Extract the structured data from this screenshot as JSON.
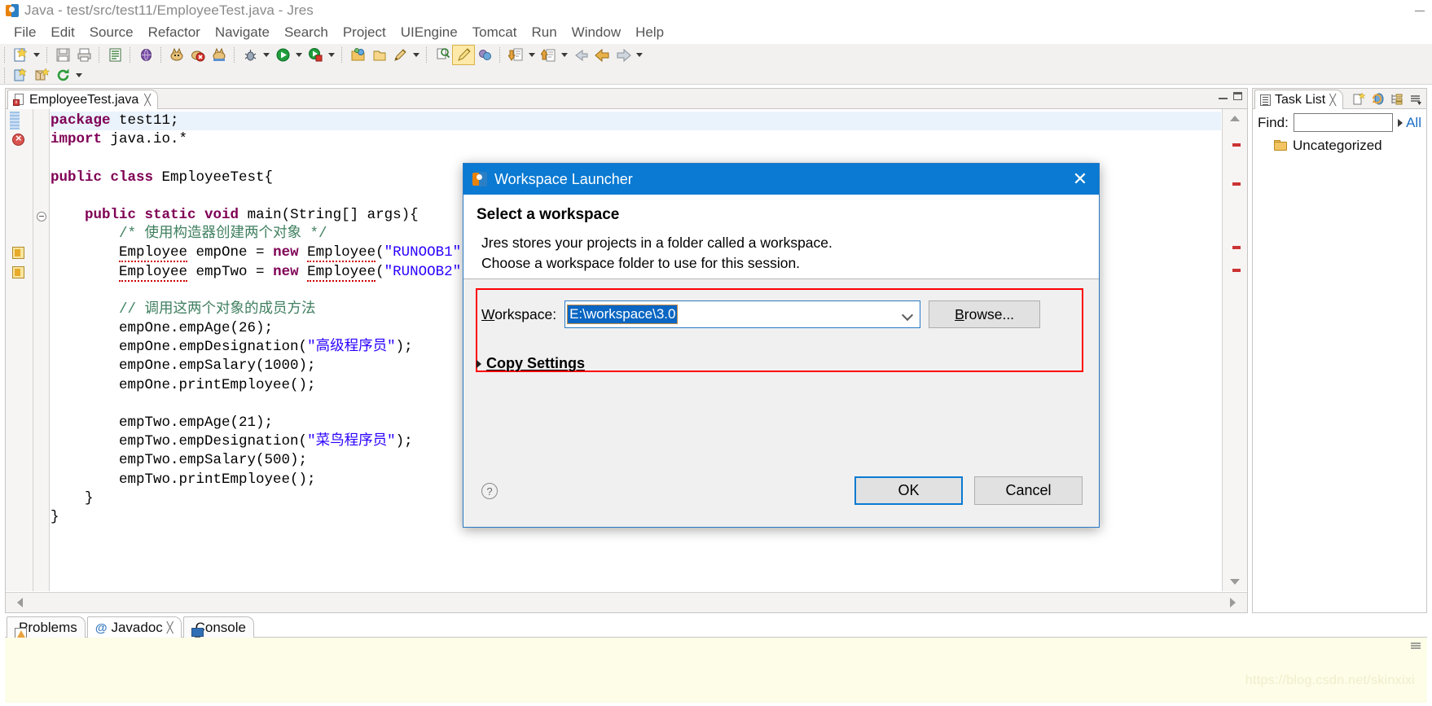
{
  "window": {
    "title": "Java - test/src/test11/EmployeeTest.java - Jres",
    "app_icon": "jres-app-icon",
    "minimize_label": "–"
  },
  "menubar": {
    "items": [
      {
        "label": "File"
      },
      {
        "label": "Edit"
      },
      {
        "label": "Source"
      },
      {
        "label": "Refactor"
      },
      {
        "label": "Navigate"
      },
      {
        "label": "Search"
      },
      {
        "label": "Project"
      },
      {
        "label": "UIEngine"
      },
      {
        "label": "Tomcat"
      },
      {
        "label": "Run"
      },
      {
        "label": "Window"
      },
      {
        "label": "Help"
      }
    ]
  },
  "toolbar": {
    "row1": [
      {
        "name": "new-wizard-icon",
        "has_arrow": true
      },
      {
        "name": "save-icon",
        "has_arrow": false
      },
      {
        "name": "print-icon",
        "has_arrow": false
      },
      {
        "name": "sep1",
        "sep": true
      },
      {
        "name": "open-task-icon",
        "has_arrow": false
      },
      {
        "name": "sep2",
        "sep": true
      },
      {
        "name": "globe-icon",
        "has_arrow": false
      },
      {
        "name": "sep3",
        "sep": true
      },
      {
        "name": "tomcat-start-icon",
        "has_arrow": false
      },
      {
        "name": "tomcat-stop-icon",
        "has_arrow": false
      },
      {
        "name": "tomcat-restart-icon",
        "has_arrow": false
      },
      {
        "name": "sep4",
        "sep": true
      },
      {
        "name": "debug-icon",
        "has_arrow": true
      },
      {
        "name": "run-icon",
        "has_arrow": true
      },
      {
        "name": "run-external-tools-icon",
        "has_arrow": true
      },
      {
        "name": "sep5",
        "sep": true
      },
      {
        "name": "new-java-package-icon",
        "has_arrow": false
      },
      {
        "name": "new-java-class-icon",
        "has_arrow": false
      },
      {
        "name": "search-pencil-icon",
        "has_arrow": true
      },
      {
        "name": "sep6",
        "sep": true
      },
      {
        "name": "open-type-icon",
        "has_arrow": false
      },
      {
        "name": "edit-highlight-icon",
        "has_arrow": false,
        "active": true
      },
      {
        "name": "annotations-icon",
        "has_arrow": false
      },
      {
        "name": "sep7",
        "sep": true
      },
      {
        "name": "next-annotation-icon",
        "has_arrow": true
      },
      {
        "name": "previous-annotation-icon",
        "has_arrow": true
      },
      {
        "name": "last-edit-location-icon",
        "has_arrow": false
      },
      {
        "name": "back-icon",
        "has_arrow": false
      },
      {
        "name": "forward-icon",
        "has_arrow": true
      }
    ],
    "row2": [
      {
        "name": "new-jsp-icon",
        "has_arrow": false
      },
      {
        "name": "new-package-icon",
        "has_arrow": false
      },
      {
        "name": "refresh-icon",
        "has_arrow": true
      }
    ]
  },
  "editor": {
    "tab": {
      "label": "EmployeeTest.java",
      "close_glyph": "╳",
      "icon": "java-file-error-icon"
    },
    "minimize_tooltip": "Minimize",
    "maximize_tooltip": "Maximize",
    "code_lines": [
      {
        "indent": 0,
        "tokens": [
          {
            "t": "package ",
            "c": "kw"
          },
          {
            "t": "test11;",
            "c": "plain"
          }
        ],
        "highlight": true
      },
      {
        "indent": 0,
        "tokens": [
          {
            "t": "import ",
            "c": "kw"
          },
          {
            "t": "java.io.*",
            "c": "plain"
          }
        ],
        "marker": "error"
      },
      {
        "indent": 0,
        "tokens": []
      },
      {
        "indent": 0,
        "tokens": [
          {
            "t": "public class ",
            "c": "kw"
          },
          {
            "t": "EmployeeTest{",
            "c": "plain"
          }
        ]
      },
      {
        "indent": 0,
        "tokens": []
      },
      {
        "indent": 1,
        "tokens": [
          {
            "t": "public static void ",
            "c": "kw"
          },
          {
            "t": "main(String[] args){",
            "c": "plain"
          }
        ],
        "fold": true
      },
      {
        "indent": 2,
        "tokens": [
          {
            "t": "/* 使用构造器创建两个对象 */",
            "c": "cmt"
          }
        ]
      },
      {
        "indent": 2,
        "tokens": [
          {
            "t": "Employee",
            "c": "plain squig"
          },
          {
            "t": " empOne = ",
            "c": "plain"
          },
          {
            "t": "new ",
            "c": "kw"
          },
          {
            "t": "Employee",
            "c": "plain squig"
          },
          {
            "t": "(",
            "c": "plain"
          },
          {
            "t": "\"RUNOOB1\"",
            "c": "str"
          },
          {
            "t": ",",
            "c": "plain"
          }
        ],
        "marker": "warn"
      },
      {
        "indent": 2,
        "tokens": [
          {
            "t": "Employee",
            "c": "plain squig"
          },
          {
            "t": " empTwo = ",
            "c": "plain"
          },
          {
            "t": "new ",
            "c": "kw"
          },
          {
            "t": "Employee",
            "c": "plain squig"
          },
          {
            "t": "(",
            "c": "plain"
          },
          {
            "t": "\"RUNOOB2\"",
            "c": "str"
          },
          {
            "t": ",",
            "c": "plain"
          }
        ],
        "marker": "warn"
      },
      {
        "indent": 0,
        "tokens": []
      },
      {
        "indent": 2,
        "tokens": [
          {
            "t": "// 调用这两个对象的成员方法",
            "c": "cmt"
          }
        ]
      },
      {
        "indent": 2,
        "tokens": [
          {
            "t": "empOne.empAge(26);",
            "c": "plain"
          }
        ]
      },
      {
        "indent": 2,
        "tokens": [
          {
            "t": "empOne.empDesignation(",
            "c": "plain"
          },
          {
            "t": "\"高级程序员\"",
            "c": "str"
          },
          {
            "t": ");",
            "c": "plain"
          }
        ]
      },
      {
        "indent": 2,
        "tokens": [
          {
            "t": "empOne.empSalary(1000);",
            "c": "plain"
          }
        ]
      },
      {
        "indent": 2,
        "tokens": [
          {
            "t": "empOne.printEmployee();",
            "c": "plain"
          }
        ]
      },
      {
        "indent": 0,
        "tokens": []
      },
      {
        "indent": 2,
        "tokens": [
          {
            "t": "empTwo.empAge(21);",
            "c": "plain"
          }
        ]
      },
      {
        "indent": 2,
        "tokens": [
          {
            "t": "empTwo.empDesignation(",
            "c": "plain"
          },
          {
            "t": "\"菜鸟程序员\"",
            "c": "str"
          },
          {
            "t": ");",
            "c": "plain"
          }
        ]
      },
      {
        "indent": 2,
        "tokens": [
          {
            "t": "empTwo.empSalary(500);",
            "c": "plain"
          }
        ]
      },
      {
        "indent": 2,
        "tokens": [
          {
            "t": "empTwo.printEmployee();",
            "c": "plain"
          }
        ]
      },
      {
        "indent": 1,
        "tokens": [
          {
            "t": "}",
            "c": "plain"
          }
        ]
      },
      {
        "indent": 0,
        "tokens": [
          {
            "t": "}",
            "c": "plain"
          }
        ]
      }
    ]
  },
  "tasklist": {
    "tab_label": "Task List",
    "close_glyph": "╳",
    "tab_icon": "task-list-icon",
    "toolbar_icons": [
      "new-task-icon",
      "synchronize-icon",
      "categorize-icon",
      "view-menu-icon"
    ],
    "find_label": "Find:",
    "find_value": "",
    "find_placeholder": "",
    "all_label": "All",
    "rows": [
      {
        "label": "Uncategorized",
        "icon": "folder-icon"
      }
    ]
  },
  "bottom_panel": {
    "tabs": [
      {
        "label": "Problems",
        "icon": "problems-icon",
        "active": false,
        "closable": false
      },
      {
        "label": "Javadoc",
        "icon": "at-icon",
        "active": true,
        "closable": true
      },
      {
        "label": "Console",
        "icon": "console-icon",
        "active": false,
        "closable": false
      }
    ],
    "close_glyph": "╳",
    "watermark": "https://blog.csdn.net/skinxixi"
  },
  "dialog": {
    "title": "Workspace Launcher",
    "title_icon": "jres-app-icon",
    "close_glyph": "✕",
    "heading": "Select a workspace",
    "description_line1": "Jres stores your projects in a folder called a workspace.",
    "description_line2": "Choose a workspace folder to use for this session.",
    "workspace_label_prefix": "W",
    "workspace_label_rest": "orkspace:",
    "workspace_value": "E:\\workspace\\3.0",
    "workspace_placeholder": "",
    "browse_label_prefix": "B",
    "browse_label_rest": "rowse...",
    "copy_settings_label_prefix": "C",
    "copy_settings_label_rest": "opy Settings",
    "help_glyph": "?",
    "ok_label": "OK",
    "cancel_label": "Cancel",
    "annotation_color": "#ff0000",
    "accent_color": "#0a7ad2"
  }
}
